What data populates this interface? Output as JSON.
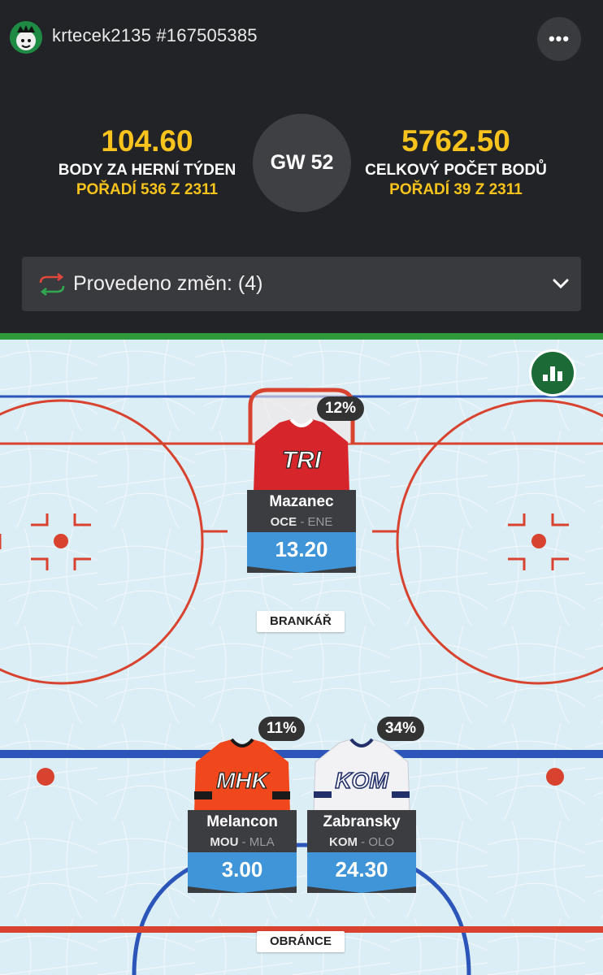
{
  "header": {
    "username": "krtecek2135 #167505385",
    "menu_label": "•••",
    "gameweek": "GW 52"
  },
  "stats": {
    "week_points": "104.60",
    "week_label": "BODY ZA HERNÍ TÝDEN",
    "week_rank": "POŘADÍ 536 Z 2311",
    "total_points": "5762.50",
    "total_label": "CELKOVÝ POČET BODŮ",
    "total_rank": "POŘADÍ 39 Z 2311"
  },
  "changes": {
    "label": "Provedeno změn: (4)"
  },
  "positions": {
    "goalie": "BRANKÁŘ",
    "defense": "OBRÁNCE"
  },
  "players": [
    {
      "name": "Mazanec",
      "team": "OCE",
      "opponent": "ENE",
      "points": "13.20",
      "ownership": "12%",
      "jersey_text": "TRI",
      "jersey_color": "#d7262b",
      "jersey_trim": "#ffffff"
    },
    {
      "name": "Melancon",
      "team": "MOU",
      "opponent": "MLA",
      "points": "3.00",
      "ownership": "11%",
      "jersey_text": "MHK",
      "jersey_color": "#f0471d",
      "jersey_trim": "#1a1a1a"
    },
    {
      "name": "Zabransky",
      "team": "KOM",
      "opponent": "OLO",
      "points": "24.30",
      "ownership": "34%",
      "jersey_text": "KOM",
      "jersey_color": "#f2f2f4",
      "jersey_trim": "#22306a"
    }
  ],
  "colors": {
    "accent": "#f7c31c",
    "points_bar": "#3f95d8",
    "rink_ice": "#dceef5",
    "rink_red": "#d8432f",
    "rink_blue": "#2b55b8"
  }
}
